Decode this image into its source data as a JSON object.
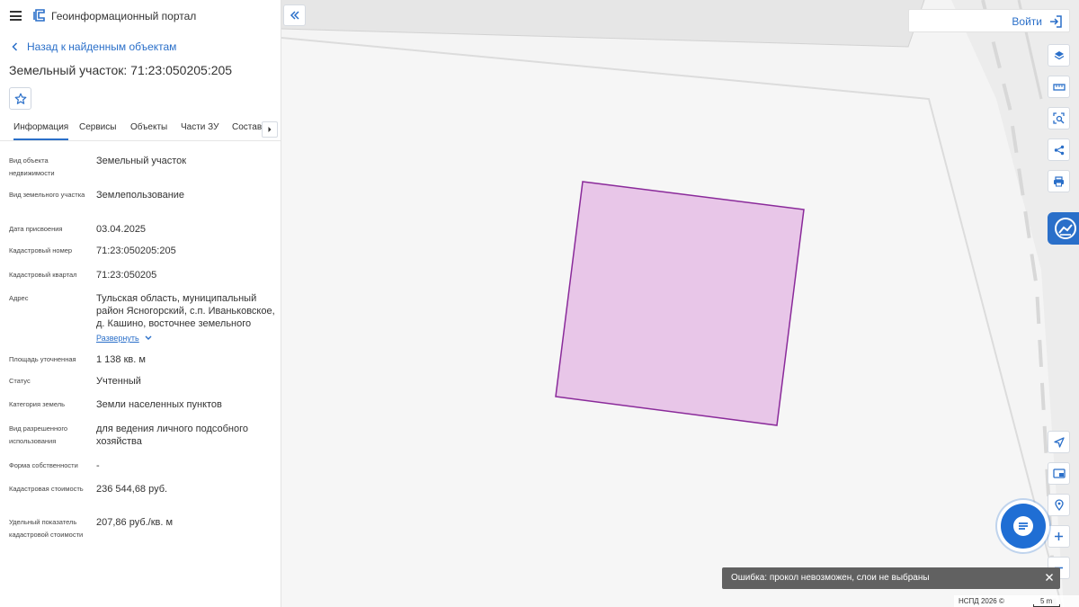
{
  "app": {
    "title": "Геоинформационный портал"
  },
  "panel": {
    "back_label": "Назад к найденным объектам",
    "object_title": "Земельный участок: 71:23:050205:205",
    "tabs": [
      {
        "label": "Информация",
        "active": true
      },
      {
        "label": "Сервисы",
        "active": false
      },
      {
        "label": "Объекты",
        "active": false
      },
      {
        "label": "Части ЗУ",
        "active": false
      },
      {
        "label": "Состав",
        "active": false
      }
    ],
    "expand_label": "Развернуть",
    "fields": [
      {
        "label": "Вид объекта недвижимости",
        "value": "Земельный участок"
      },
      {
        "label": "Вид земельного участка",
        "value": "Землепользование"
      },
      {
        "label": "Дата присвоения",
        "value": "03.04.2025"
      },
      {
        "label": "Кадастровый номер",
        "value": "71:23:050205:205"
      },
      {
        "label": "Кадастровый квартал",
        "value": "71:23:050205"
      },
      {
        "label": "Адрес",
        "value": "Тульская область, муниципальный район Ясногорский, с.п. Иваньковское, д. Кашино, восточнее земельного"
      },
      {
        "label": "Площадь уточненная",
        "value": "1 138 кв. м"
      },
      {
        "label": "Статус",
        "value": "Учтенный"
      },
      {
        "label": "Категория земель",
        "value": "Земли населенных пунктов"
      },
      {
        "label": "Вид разрешенного использования",
        "value": "для ведения личного подсобного хозяйства"
      },
      {
        "label": "Форма собственности",
        "value": "-"
      },
      {
        "label": "Кадастровая стоимость",
        "value": "236 544,68 руб."
      },
      {
        "label": "Удельный показатель кадастровой стоимости",
        "value": "207,86 руб./кв. м"
      }
    ]
  },
  "map": {
    "login_label": "Войти",
    "toast_message": "Ошибка: прокол невозможен, слои не выбраны",
    "copyright": "НСПД 2026 ©",
    "scale_label": "5 m",
    "parcel_fill": "#e8c6e8",
    "parcel_stroke": "#8a2a9a"
  },
  "colors": {
    "accent": "#2a6fc9"
  },
  "icons": {
    "toolbar_top": [
      "layers-icon",
      "ruler-icon",
      "zoom-select-icon",
      "share-icon",
      "print-icon"
    ],
    "toolbar_bottom": [
      "locate-icon",
      "picture-in-picture-icon",
      "pin-search-icon",
      "zoom-in-icon",
      "zoom-out-icon"
    ]
  }
}
